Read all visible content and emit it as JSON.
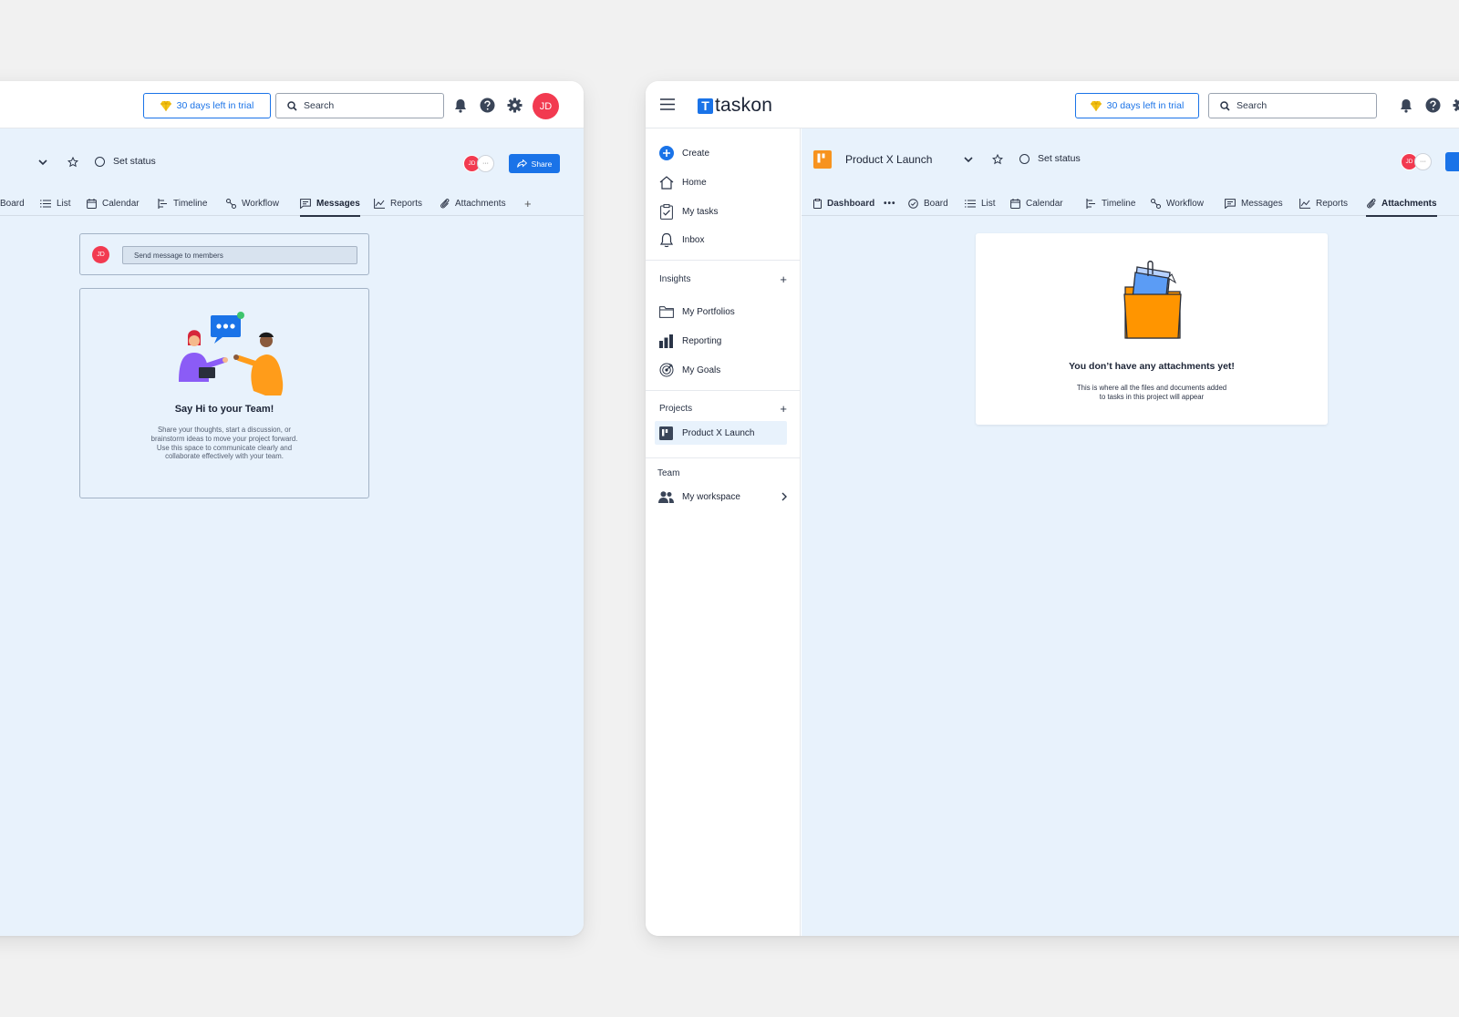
{
  "colors": {
    "accent": "#1a73e8",
    "avatar": "#f23a50",
    "workarea": "#e8f2fc",
    "project_icon": "#f7931e"
  },
  "left_window": {
    "trial_label": "30 days left in trial",
    "search_placeholder": "Search",
    "avatar_initials": "JD",
    "set_status": "Set status",
    "member_initials": "JD",
    "more_members": "···",
    "share_label": "Share",
    "tabs": [
      "Board",
      "List",
      "Calendar",
      "Timeline",
      "Workflow",
      "Messages",
      "Reports",
      "Attachments"
    ],
    "active_tab": "Messages",
    "add_tab": "+",
    "composer": {
      "avatar_initials": "JD",
      "placeholder": "Send message to members"
    },
    "empty_state": {
      "title": "Say Hi to your Team!",
      "body_lines": [
        "Share your thoughts, start a discussion, or",
        "brainstorm ideas to move your project forward.",
        "Use this space to communicate clearly and",
        "collaborate effectively with your team."
      ]
    }
  },
  "right_window": {
    "logo_text": "taskon",
    "logo_letter": "T",
    "trial_label": "30 days left in trial",
    "search_placeholder": "Search",
    "sidebar": {
      "create": "Create",
      "home": "Home",
      "my_tasks": "My tasks",
      "inbox": "Inbox",
      "insights_heading": "Insights",
      "add": "+",
      "my_portfolios": "My Portfolios",
      "reporting": "Reporting",
      "my_goals": "My Goals",
      "projects_heading": "Projects",
      "project_item": "Product X Launch",
      "team_heading": "Team",
      "workspace": "My workspace"
    },
    "project_title": "Product X Launch",
    "set_status": "Set status",
    "member_initials": "JD",
    "more_members": "···",
    "tabs": [
      "Dashboard",
      "Board",
      "List",
      "Calendar",
      "Timeline",
      "Workflow",
      "Messages",
      "Reports",
      "Attachments"
    ],
    "active_tab": "Attachments",
    "empty_state": {
      "title": "You don’t have any attachments yet!",
      "body_lines": [
        "This is where all the files and documents added",
        "to tasks in this project will appear"
      ]
    }
  }
}
